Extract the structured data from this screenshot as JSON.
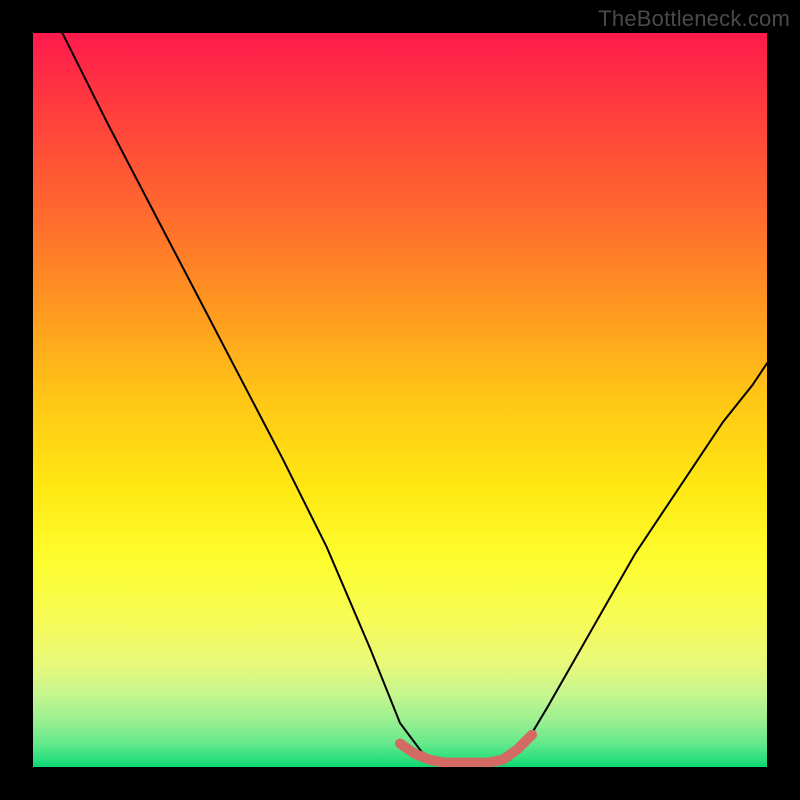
{
  "watermark": "TheBottleneck.com",
  "chart_data": {
    "type": "line",
    "title": "",
    "xlabel": "",
    "ylabel": "",
    "xlim": [
      0,
      100
    ],
    "ylim": [
      0,
      100
    ],
    "grid": false,
    "series": [
      {
        "name": "main-curve",
        "color": "#000000",
        "stroke_width": 2,
        "x": [
          4,
          10,
          16,
          22,
          28,
          34,
          40,
          46,
          50,
          53,
          55,
          57,
          59,
          61,
          63,
          65,
          67,
          70,
          74,
          78,
          82,
          86,
          90,
          94,
          98,
          100
        ],
        "y": [
          100,
          88,
          76.5,
          65,
          53.5,
          42,
          30,
          16,
          6,
          2,
          1,
          0.5,
          0.5,
          0.5,
          0.5,
          1,
          3,
          8,
          15,
          22,
          29,
          35,
          41,
          47,
          52,
          55
        ]
      },
      {
        "name": "bottom-highlight",
        "color": "#d36a63",
        "stroke_width": 10,
        "x": [
          50,
          52,
          54,
          56,
          58,
          60,
          62,
          64,
          66,
          68
        ],
        "y": [
          3.2,
          1.8,
          1.0,
          0.6,
          0.6,
          0.6,
          0.6,
          1.0,
          2.4,
          4.4
        ]
      }
    ],
    "background_gradient": {
      "top": "#ff1a4d",
      "middle": "#ffe813",
      "bottom": "#0bd96f"
    }
  }
}
